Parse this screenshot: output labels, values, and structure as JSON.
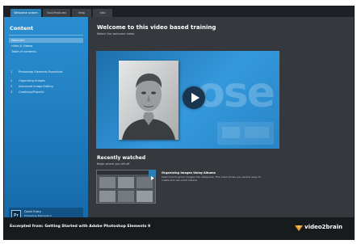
{
  "tabs": [
    {
      "label": "Welcome screen"
    },
    {
      "label": "Tour/Features"
    },
    {
      "label": "Help"
    },
    {
      "label": "Info"
    }
  ],
  "sidebar": {
    "title": "Content",
    "items": [
      {
        "label": "Welcome"
      },
      {
        "label": "Hints & Videos"
      },
      {
        "label": "Table of contents"
      }
    ],
    "chapters": [
      {
        "num": "1",
        "label": "Photoshop Elements Essentials"
      },
      {
        "num": "2",
        "label": "Organizing Images"
      },
      {
        "num": "3",
        "label": "Advanced Image Editing"
      },
      {
        "num": "4",
        "label": "Creations/Projects"
      }
    ],
    "book": {
      "icon": "Pr",
      "title": "Quick Entry",
      "sub1": "Photoshop Elements 9",
      "sub2": "Part 1 / Intro"
    }
  },
  "main": {
    "title": "Welcome to this video based training",
    "subtitle": "Watch the welcome video",
    "video_bg_text": "ose",
    "recent": {
      "title": "Recently watched",
      "subtitle": "Begin where you left off",
      "item_title": "Organizing Images Using Albums",
      "item_desc": "Learn how to group images into categories. This video shows you several ways to create and use smart albums."
    }
  },
  "footer": {
    "text": "Excerpted from: Getting Started with Adobe Photoshop Elements 9",
    "brand": "video2brain"
  },
  "colors": {
    "accent": "#2b8ed0",
    "brand_orange": "#f0a030"
  }
}
